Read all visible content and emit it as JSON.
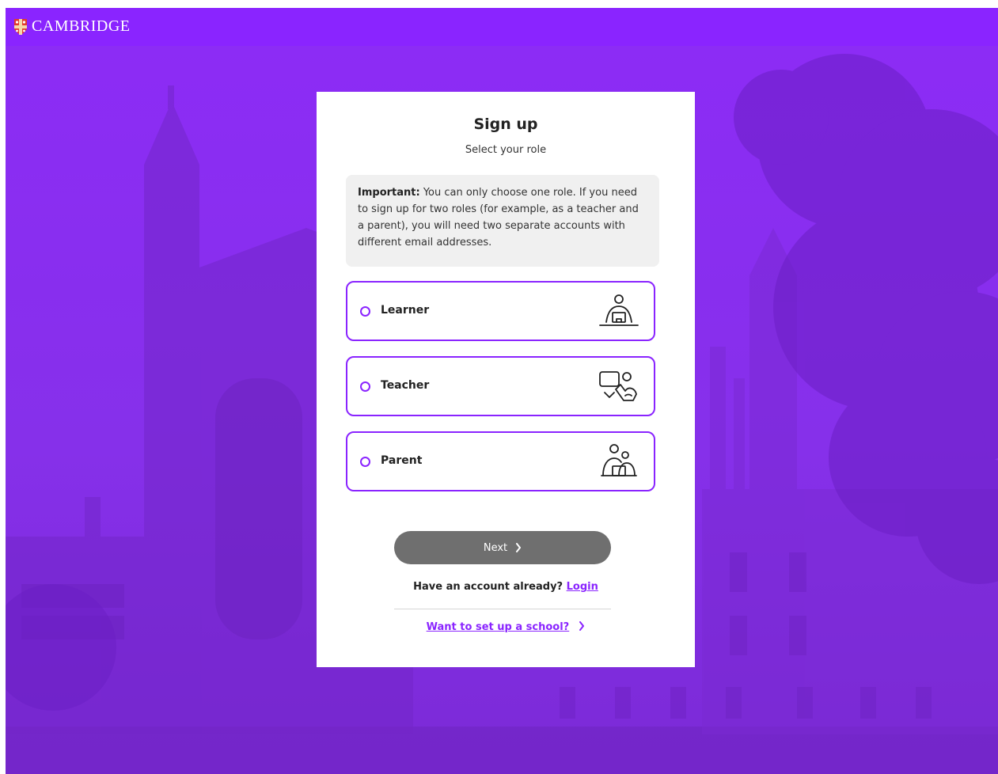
{
  "brand": {
    "name": "CAMBRIDGE",
    "logo_icon": "cambridge-shield-icon"
  },
  "form": {
    "title": "Sign up",
    "subtitle": "Select your role",
    "notice": {
      "label": "Important:",
      "text": "You can only choose one role. If you need to sign up for two roles (for example, as a teacher and a parent), you will need two separate accounts with different email addresses."
    },
    "roles": [
      {
        "label": "Learner",
        "icon": "learner-icon",
        "selected": false
      },
      {
        "label": "Teacher",
        "icon": "teacher-icon",
        "selected": false
      },
      {
        "label": "Parent",
        "icon": "parent-icon",
        "selected": false
      }
    ],
    "next_label": "Next",
    "login_prompt": "Have an account already?",
    "login_link": "Login",
    "school_link": "Want to set up a school?"
  },
  "colors": {
    "accent": "#8a24ff",
    "button_disabled": "#6f6f6f",
    "notice_bg": "#f0f0f0"
  }
}
